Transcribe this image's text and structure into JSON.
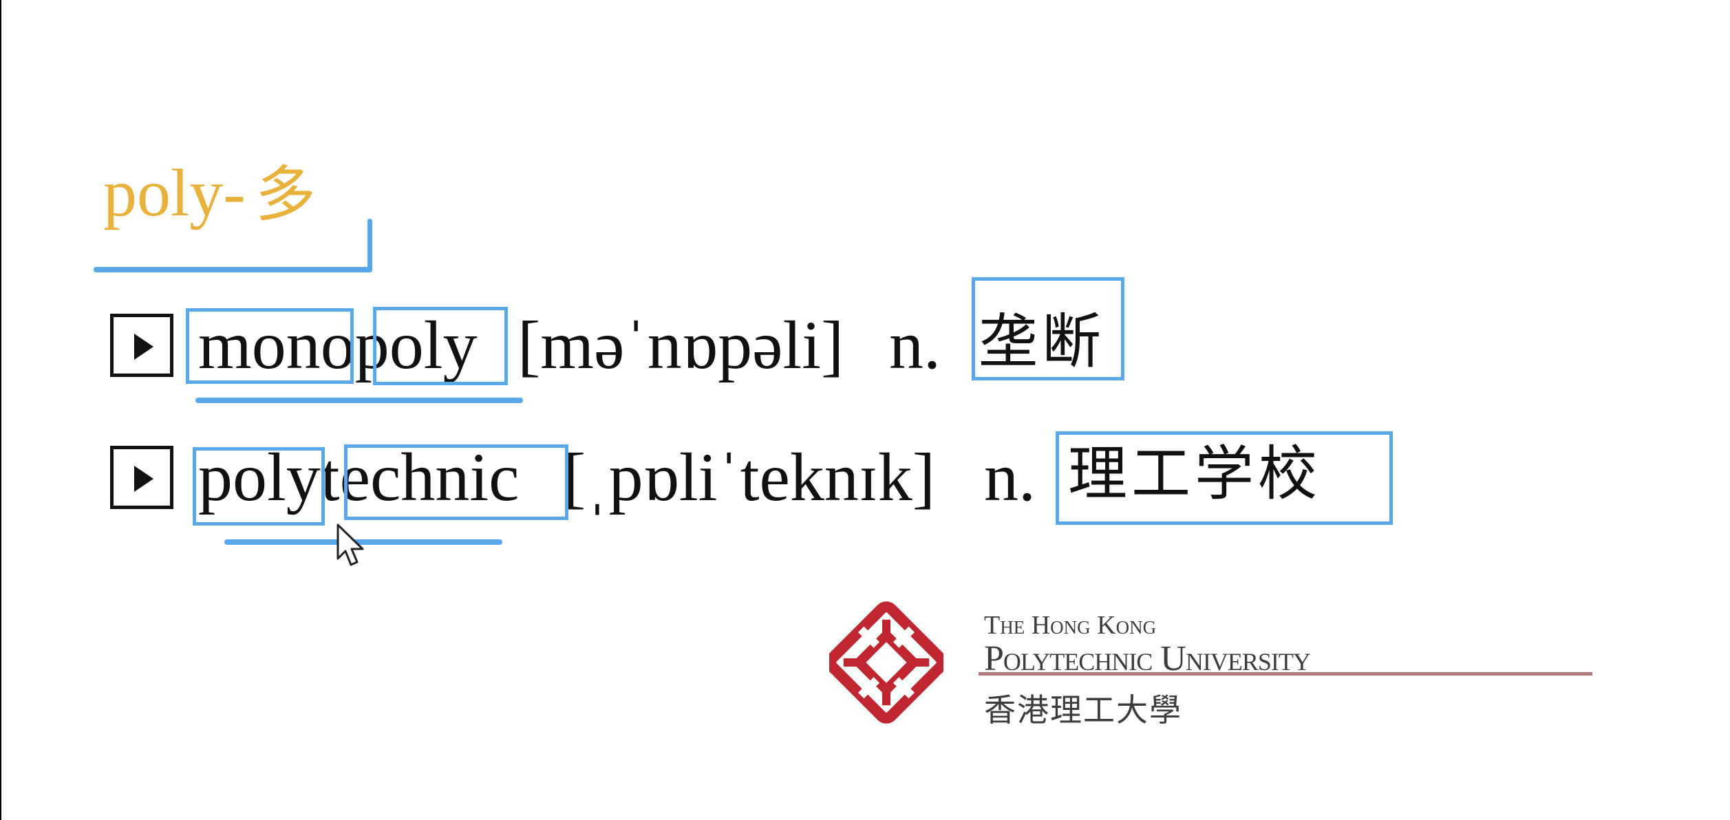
{
  "heading": {
    "prefix": "poly-",
    "meaning": "多"
  },
  "words": [
    {
      "word": "monopoly",
      "phonetic": "[məˈnɒpəli]",
      "pos": "n.",
      "definition": "垄断"
    },
    {
      "word": "polytechnic",
      "phonetic": "[ˌpɒliˈteknɪk]",
      "pos": "n.",
      "definition": "理工学校"
    }
  ],
  "logo": {
    "line1": "The Hong Kong",
    "line2": "Polytechnic University",
    "line3": "香港理工大學",
    "color": "#c0262f"
  },
  "colors": {
    "heading": "#e7b13c",
    "annotation": "#5aa7ea",
    "text": "#111111"
  },
  "icons": [
    "play-icon",
    "mouse-cursor-icon"
  ]
}
